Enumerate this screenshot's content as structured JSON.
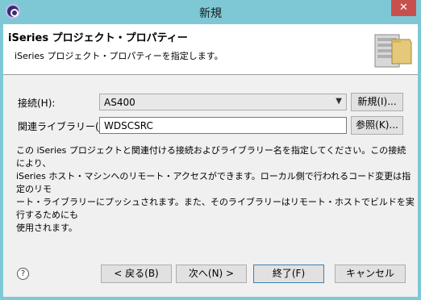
{
  "window": {
    "title": "新規",
    "close_glyph": "✕"
  },
  "header": {
    "title": "iSeries プロジェクト・プロパティー",
    "description": "iSeries プロジェクト・プロパティーを指定します。"
  },
  "form": {
    "connection_label": "接続(H):",
    "connection_value": "AS400",
    "new_button": "新規(I)...",
    "library_label": "関連ライブラリー(J):",
    "library_value": "WDSCSRC",
    "browse_button": "参照(K)..."
  },
  "info": {
    "lines": [
      "この iSeries プロジェクトと関連付ける接続およびライブラリー名を指定してください。この接続により、",
      "iSeries ホスト・マシンへのリモート・アクセスができます。ローカル側で行われるコード変更は指定のリモ",
      "ート・ライブラリーにプッシュされます。また、そのライブラリーはリモート・ホストでビルドを実行するためにも",
      "使用されます。"
    ]
  },
  "footer": {
    "help_glyph": "?",
    "back_button": "< 戻る(B)",
    "next_button": "次へ(N) >",
    "finish_button": "終了(F)",
    "cancel_button": "キャンセル"
  },
  "icons": {
    "app": "eclipse-icon",
    "banner": "server-project-icon",
    "combo_arrow": "chevron-down-icon",
    "help": "help-icon"
  }
}
